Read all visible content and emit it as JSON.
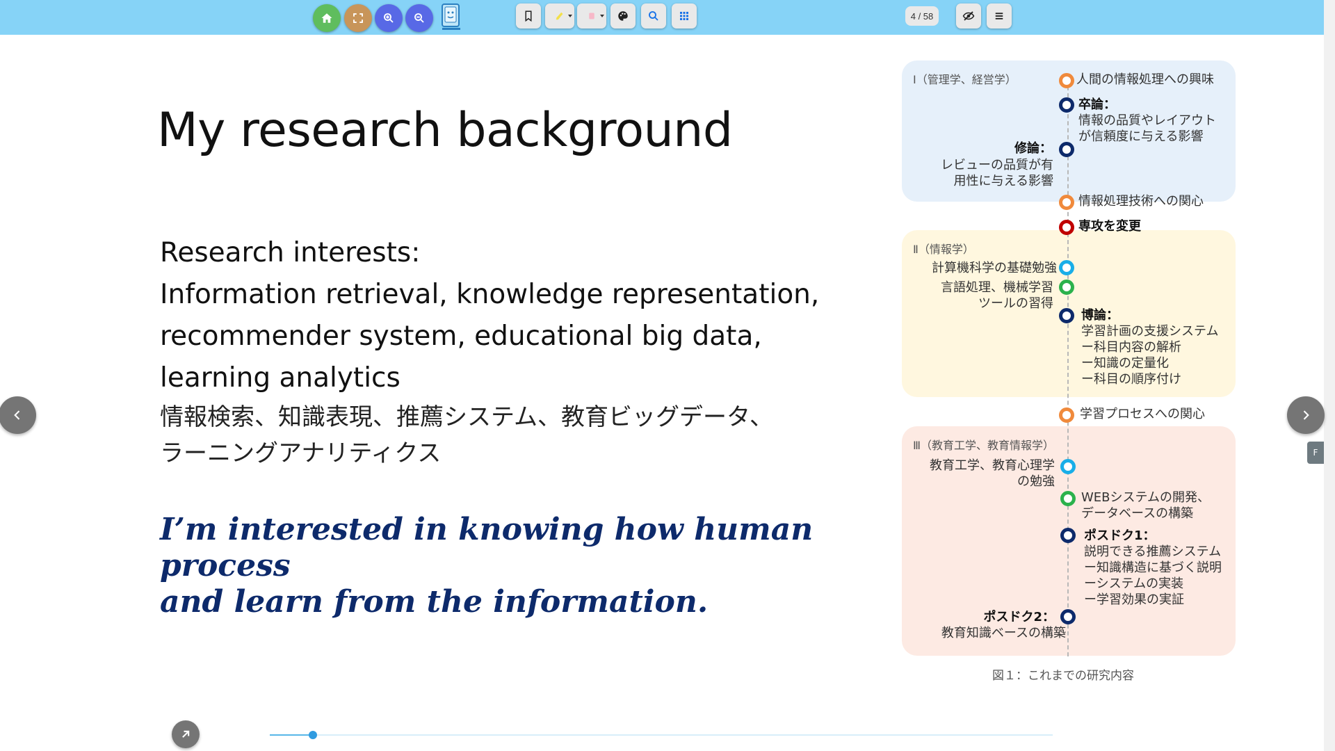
{
  "toolbar": {
    "page_indicator": "4 / 58",
    "colors": {
      "home": "#5fbd5e",
      "fullscreen": "#c8955a",
      "zoom": "#5869e6",
      "bar": "#86d3f7"
    },
    "icons": [
      "home-icon",
      "fullscreen-icon",
      "zoom-in-icon",
      "zoom-out-icon",
      "bookmark-icon",
      "highlighter-icon",
      "eraser-icon",
      "palette-icon",
      "search-icon",
      "grid-icon",
      "hide-icon",
      "menu-icon"
    ]
  },
  "slide": {
    "title": "My research background",
    "interests_heading": "Research interests:",
    "interests_en_1": "Information retrieval, knowledge representation,",
    "interests_en_2": "recommender system, educational big data,",
    "interests_en_3": "learning analytics",
    "interests_ja_1": "情報検索、知識表現、推薦システム、教育ビッグデータ、",
    "interests_ja_2": "ラーニングアナリティクス",
    "quote_1": "I’m interested in knowing how human process",
    "quote_2": "and learn from the information."
  },
  "figure": {
    "panel1_label": "Ⅰ（管理学、経営学）",
    "panel2_label": "Ⅱ（情報学）",
    "panel3_label": "Ⅲ（教育工学、教育情報学）",
    "t1": "人間の情報処理への興味",
    "t2_title": "卒論：",
    "t2_l1": "情報の品質やレイアウト",
    "t2_l2": "が信頼度に与える影響",
    "t3_title": "修論：",
    "t3_l1": "レビューの品質が有",
    "t3_l2": "用性に与える影響",
    "t4": "情報処理技術への関心",
    "t5": "専攻を変更",
    "t6": "計算機科学の基礎勉強",
    "t7_l1": "言語処理、機械学習",
    "t7_l2": "ツールの習得",
    "t8_title": "博論：",
    "t8_l1": "学習計画の支援システム",
    "t8_l2": "ー科目内容の解析",
    "t8_l3": "ー知識の定量化",
    "t8_l4": "ー科目の順序付け",
    "t9": "学習プロセスへの関心",
    "t10_l1": "教育工学、教育心理学",
    "t10_l2": "の勉強",
    "t11_l1": "WEBシステムの開発、",
    "t11_l2": "データベースの構築",
    "t12_title": "ポスドク1：",
    "t12_l1": "説明できる推薦システム",
    "t12_l2": "ー知識構造に基づく説明",
    "t12_l3": "ーシステムの実装",
    "t12_l4": "ー学習効果の実証",
    "t13_title": "ポスドク2：",
    "t13_l1": "教育知識ベースの構築",
    "caption": "図１：これまでの研究内容",
    "node_colors": {
      "orange": "#f08a3c",
      "navy": "#0d2a6b",
      "red": "#c00000",
      "cyan": "#19aee8",
      "green": "#2bb24c"
    }
  },
  "side": {
    "tab_letter": "F"
  },
  "progress": {
    "fraction": 0.055
  }
}
